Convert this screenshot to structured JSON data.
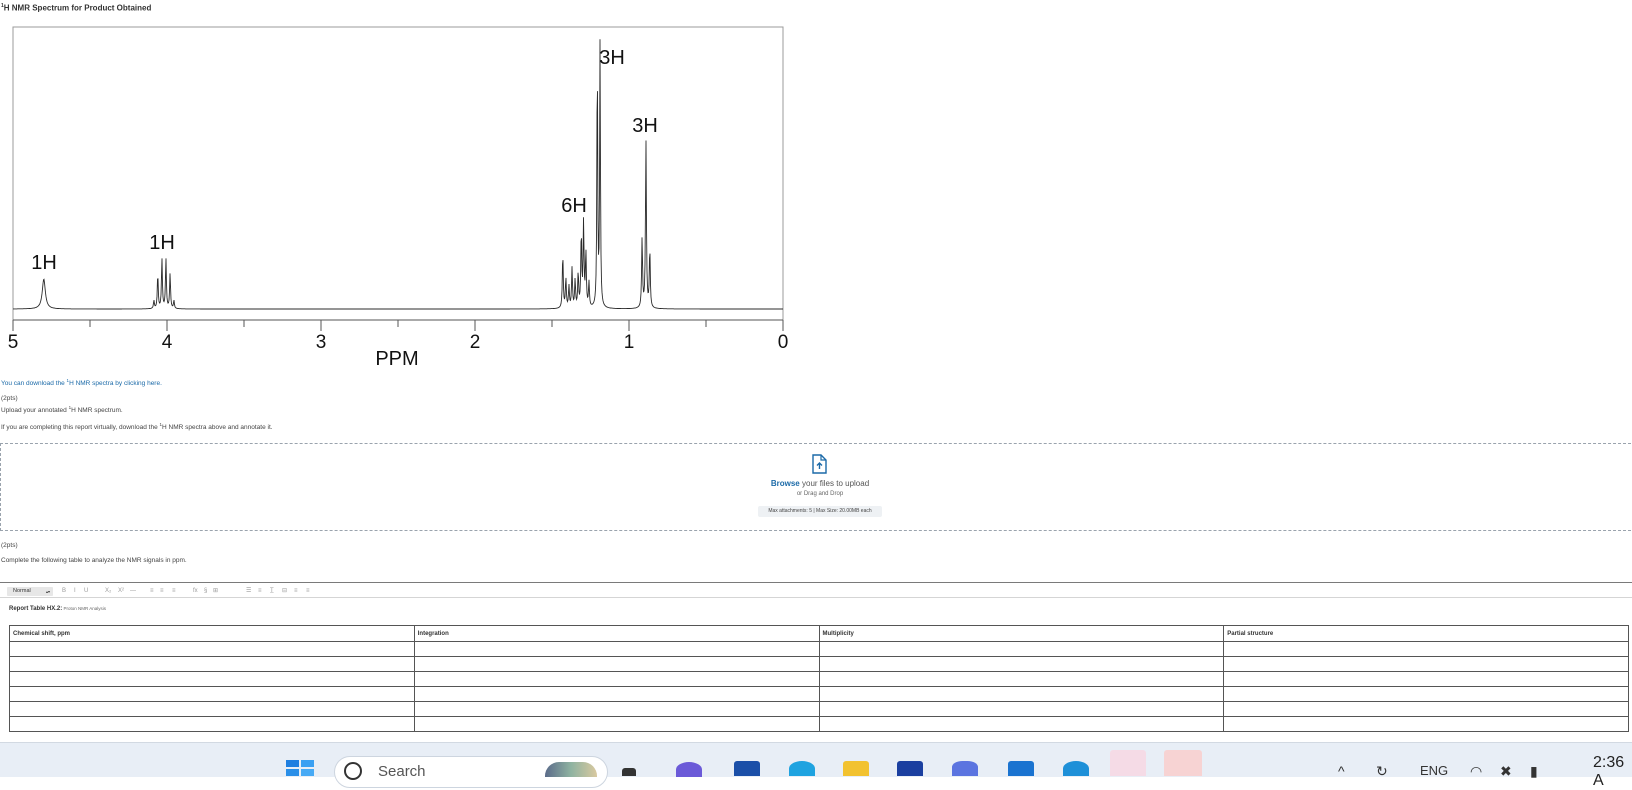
{
  "spectrum": {
    "title_sup": "1",
    "title": "H NMR Spectrum for Product Obtained",
    "xlabel": "PPM",
    "ticks": [
      "5",
      "4",
      "3",
      "2",
      "1",
      "0"
    ],
    "peak_labels": [
      "1H",
      "1H",
      "6H",
      "3H",
      "3H"
    ]
  },
  "chart_data": {
    "type": "line",
    "title": "1H NMR Spectrum for Product Obtained",
    "xlabel": "PPM",
    "ylabel": "",
    "xlim": [
      5,
      0
    ],
    "x_reversed": true,
    "grid": false,
    "series": [
      {
        "peaks": [
          {
            "ppm": 4.8,
            "integration": "1H",
            "multiplicity": "singlet"
          },
          {
            "ppm": 4.02,
            "integration": "1H",
            "multiplicity": "multiplet"
          },
          {
            "ppm": 1.32,
            "integration": "6H",
            "multiplicity": "multiplet"
          },
          {
            "ppm": 1.2,
            "integration": "3H",
            "multiplicity": "singlet"
          },
          {
            "ppm": 0.89,
            "integration": "3H",
            "multiplicity": "triplet"
          }
        ]
      }
    ]
  },
  "links": {
    "download_pre": "You can download the ",
    "download_sup": "1",
    "download_post": "H NMR spectra by clicking here."
  },
  "upload_question": {
    "points": "(2pts)",
    "prompt_pre": "Upload your annotated ",
    "prompt_sup": "1",
    "prompt_post": "H NMR spectrum.",
    "instruction_pre": "If you are completing this report virtually, download the ",
    "instruction_sup": "1",
    "instruction_post": "H NMR spectra above and annotate it."
  },
  "upload_zone": {
    "browse": "Browse",
    "browse_rest": " your files to upload",
    "drag": "or Drag and Drop",
    "max": "Max attachments: 5 | Max Size: 20.00MB each"
  },
  "table_question": {
    "points": "(2pts)",
    "prompt": "Complete the following table to analyze the NMR signals in ppm."
  },
  "editor": {
    "format_value": "Normal",
    "toolbar_items": [
      "B",
      "I",
      "U",
      "X₂",
      "X²",
      "—",
      "≡",
      "≡",
      "≡",
      "fx",
      "§",
      "⊞",
      "☰",
      "≡",
      "T̲",
      "⊟",
      "≡",
      "≡"
    ]
  },
  "report_table": {
    "caption_bold": "Report Table HX.2:",
    "caption_rest": " Proton NMR Analysis",
    "headers": [
      "Chemical shift, ppm",
      "Integration",
      "Multiplicity",
      "Partial structure"
    ],
    "empty_rows": 6
  },
  "taskbar": {
    "search_placeholder": "Search",
    "lang": "ENG",
    "time": "2:36 A"
  }
}
